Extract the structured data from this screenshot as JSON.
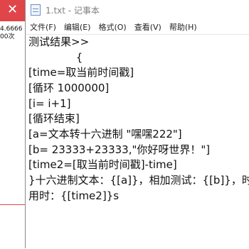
{
  "background_window": {
    "close_glyph": "✕",
    "lines": [
      "4.6666",
      "00次"
    ]
  },
  "window": {
    "title": "1.txt - 记事本"
  },
  "menu": [
    "文件(F)",
    "编辑(E)",
    "格式(O)",
    "查看(V)",
    "帮助(H)"
  ],
  "editor": {
    "lines": [
      "测试结果>>",
      "              {",
      "[time=取当前时间戳]",
      "[循环 1000000]",
      "[i= i+1]",
      "[循环结束]",
      "[a=文本转十六进制 \"嘿嘿222\"]",
      "[b= 23333+23333,\"你好呀世界！\"]",
      "[time2=[取当前时间戳]-time]",
      "}十六进制文本：{[a]}，相加测试：{[b]}，时",
      "用时：{[time2]}s"
    ]
  }
}
